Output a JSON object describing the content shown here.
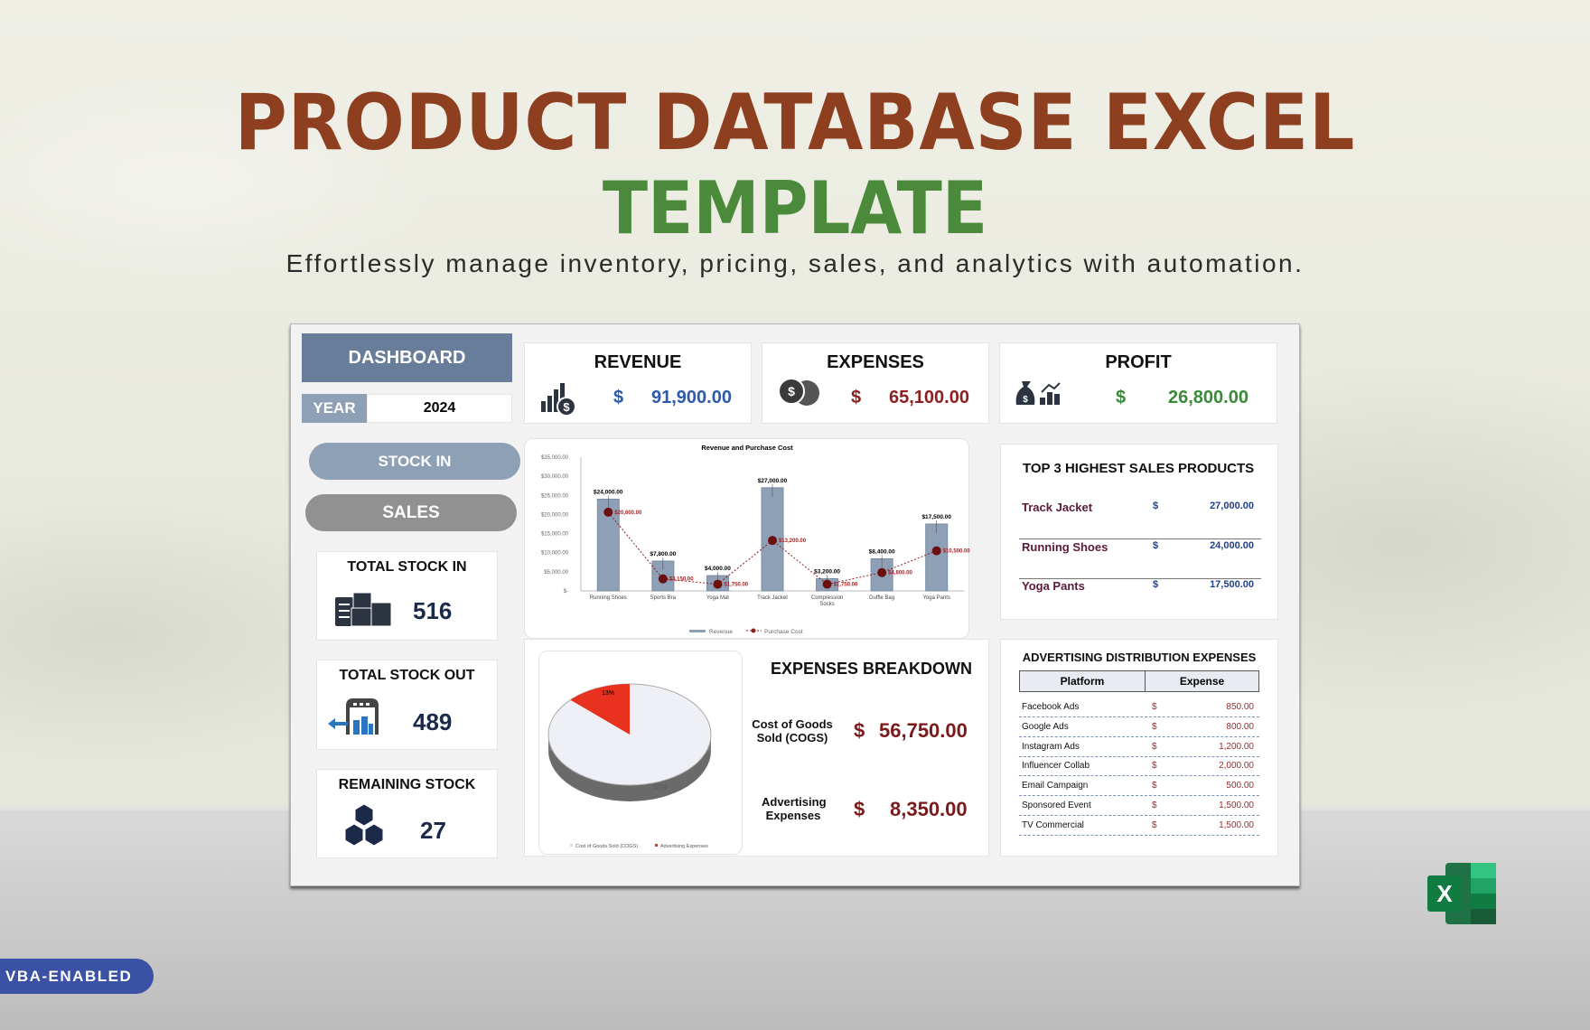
{
  "banner": {
    "title_line1": "PRODUCT DATABASE EXCEL",
    "title_line2": "TEMPLATE",
    "subtitle": "Effortlessly manage inventory, pricing, sales, and analytics with automation.",
    "badge": "VBA-ENABLED",
    "app_icon": "excel-icon"
  },
  "colors": {
    "title": "#8e3f1f",
    "title2": "#4a8a3a",
    "dashboard_header": "#677d99",
    "revenue": "#2e5aa8",
    "expenses": "#8e1f1f",
    "profit": "#3a8a3a",
    "bar": "#8ea0b6",
    "cost_line": "#6b0f0f"
  },
  "sidebar": {
    "header": "DASHBOARD",
    "year_label": "YEAR",
    "year_value": "2024",
    "stock_in_button": "STOCK IN",
    "sales_button": "SALES",
    "cards": [
      {
        "label": "TOTAL STOCK IN",
        "value": "516",
        "icon": "inventory-boxes-icon"
      },
      {
        "label": "TOTAL STOCK OUT",
        "value": "489",
        "icon": "warehouse-out-icon"
      },
      {
        "label": "REMAINING STOCK",
        "value": "27",
        "icon": "cubes-icon"
      }
    ]
  },
  "kpis": [
    {
      "label": "REVENUE",
      "currency": "$",
      "value": "91,900.00",
      "icon": "revenue-chart-icon"
    },
    {
      "label": "EXPENSES",
      "currency": "$",
      "value": "65,100.00",
      "icon": "coins-icon"
    },
    {
      "label": "PROFIT",
      "currency": "$",
      "value": "26,800.00",
      "icon": "money-bag-growth-icon"
    }
  ],
  "top3": {
    "title": "TOP 3 HIGHEST SALES PRODUCTS",
    "rows": [
      {
        "name": "Track Jacket",
        "currency": "$",
        "amount": "27,000.00"
      },
      {
        "name": "Running Shoes",
        "currency": "$",
        "amount": "24,000.00"
      },
      {
        "name": "Yoga Pants",
        "currency": "$",
        "amount": "17,500.00"
      }
    ]
  },
  "expenses_breakdown": {
    "title": "EXPENSES BREAKDOWN",
    "items": [
      {
        "label": "Cost of Goods Sold (COGS)",
        "currency": "$",
        "value": "56,750.00"
      },
      {
        "label": "Advertising Expenses",
        "currency": "$",
        "value": "8,350.00"
      }
    ]
  },
  "advertising": {
    "title": "ADVERTISING DISTRIBUTION EXPENSES",
    "headers": [
      "Platform",
      "Expense"
    ],
    "rows": [
      {
        "platform": "Facebook Ads",
        "currency": "$",
        "amount": "850.00"
      },
      {
        "platform": "Google Ads",
        "currency": "$",
        "amount": "800.00"
      },
      {
        "platform": "Instagram Ads",
        "currency": "$",
        "amount": "1,200.00"
      },
      {
        "platform": "Influencer Collab",
        "currency": "$",
        "amount": "2,000.00"
      },
      {
        "platform": "Email Campaign",
        "currency": "$",
        "amount": "500.00"
      },
      {
        "platform": "Sponsored Event",
        "currency": "$",
        "amount": "1,500.00"
      },
      {
        "platform": "TV Commercial",
        "currency": "$",
        "amount": "1,500.00"
      }
    ]
  },
  "chart_data": [
    {
      "type": "bar",
      "title": "Revenue and Purchase Cost",
      "categories": [
        "Running Shoes",
        "Sports Bra",
        "Yoga Mat",
        "Track Jacket",
        "Compression Socks",
        "Duffle Bag",
        "Yoga Pants"
      ],
      "series": [
        {
          "name": "Revenue",
          "type": "bar",
          "values": [
            24000,
            7800,
            4000,
            27000,
            3200,
            8400,
            17500
          ],
          "labels": [
            "$24,000.00",
            "$7,800.00",
            "$4,000.00",
            "$27,000.00",
            "$3,200.00",
            "$8,400.00",
            "$17,500.00"
          ]
        },
        {
          "name": "Purchase Cost",
          "type": "line",
          "values": [
            20600,
            3150,
            1750,
            13200,
            1750,
            4800,
            10500
          ],
          "labels": [
            "$20,600.00",
            "$3,150.00",
            "$1,750.00",
            "$13,200.00",
            "$1,750.00",
            "$4,800.00",
            "$10,500.00"
          ]
        }
      ],
      "ylim": [
        0,
        35000
      ],
      "yticks": [
        "$-",
        "$5,000.00",
        "$10,000.00",
        "$15,000.00",
        "$20,000.00",
        "$25,000.00",
        "$30,000.00",
        "$35,000.00"
      ],
      "legend": "bottom",
      "xlabel": "",
      "ylabel": ""
    },
    {
      "type": "pie",
      "title": "",
      "categories": [
        "Cost of Goods Sold (COGS)",
        "Advertising Expenses"
      ],
      "values": [
        87,
        13
      ],
      "labels": [
        "87%",
        "13%"
      ],
      "colors": [
        "#eef0f6",
        "#e8321f"
      ],
      "legend": "bottom"
    }
  ]
}
